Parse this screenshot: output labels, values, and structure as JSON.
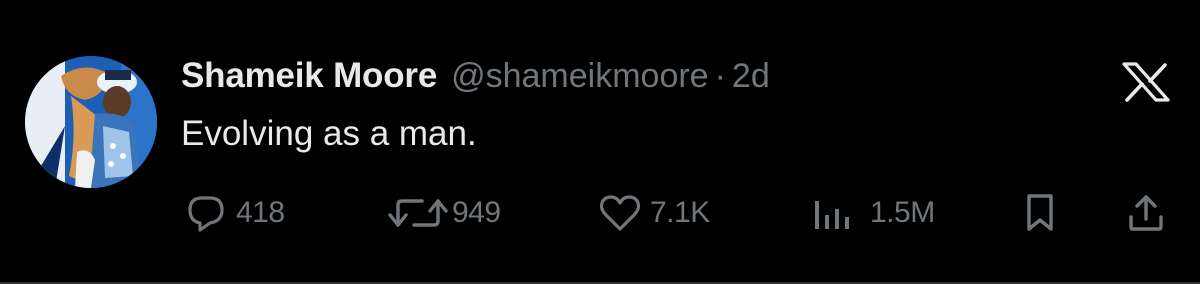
{
  "author": {
    "display_name": "Shameik Moore",
    "handle": "@shameikmoore",
    "separator": "·",
    "time": "2d"
  },
  "tweet": {
    "text": "Evolving as a man."
  },
  "actions": {
    "reply": {
      "icon": "reply-icon",
      "count": "418"
    },
    "retweet": {
      "icon": "retweet-icon",
      "count": "949"
    },
    "like": {
      "icon": "heart-icon",
      "count": "7.1K"
    },
    "views": {
      "icon": "analytics-icon",
      "count": "1.5M"
    },
    "bookmark": {
      "icon": "bookmark-icon"
    },
    "share": {
      "icon": "share-icon"
    }
  },
  "brand": {
    "icon": "x-logo-icon"
  },
  "colors": {
    "background": "#000000",
    "primary_text": "#e7e9ea",
    "secondary_text": "#71767b"
  }
}
